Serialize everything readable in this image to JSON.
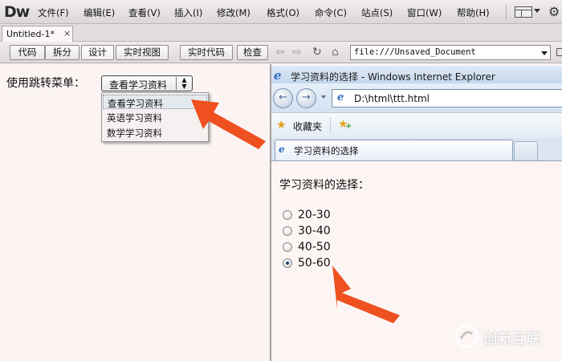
{
  "menubar": {
    "app_logo": "Dw",
    "items": [
      "文件(F)",
      "编辑(E)",
      "查看(V)",
      "插入(I)",
      "修改(M)",
      "格式(O)",
      "命令(C)",
      "站点(S)",
      "窗口(W)",
      "帮助(H)"
    ],
    "layout_icon": "layout-icon",
    "settings_icon": "gear-icon"
  },
  "document_tab": {
    "title": "Untitled-1*",
    "close": "×"
  },
  "doc_toolbar": {
    "views": [
      "代码",
      "拆分",
      "设计",
      "实时视图"
    ],
    "live_code": "实时代码",
    "inspect": "检查",
    "nav_icons": {
      "back": "back-arrow-icon",
      "forward": "forward-arrow-icon",
      "refresh": "refresh-icon",
      "home": "home-icon"
    },
    "address": "file:///Unsaved_Document"
  },
  "design_view": {
    "label": "使用跳转菜单：",
    "select_value": "查看学习资料",
    "options": [
      "查看学习资料",
      "英语学习资料",
      "数学学习资料"
    ],
    "highlighted_index": 0
  },
  "browser": {
    "title": "学习资料的选择 - Windows Internet Explorer",
    "address": "D:\\html\\ttt.html",
    "favorites_label": "收藏夹",
    "tab_title": "学习资料的选择",
    "content": {
      "heading": "学习资料的选择：",
      "options": [
        " 20-30",
        "30-40",
        "40-50",
        "50-60"
      ],
      "checked_index": 3
    }
  },
  "watermark": {
    "text": "创新互联"
  },
  "colors": {
    "arrow": "#ef5020",
    "ie_blue": "#2c6fc1",
    "page_bg": "#fbf4f3"
  }
}
